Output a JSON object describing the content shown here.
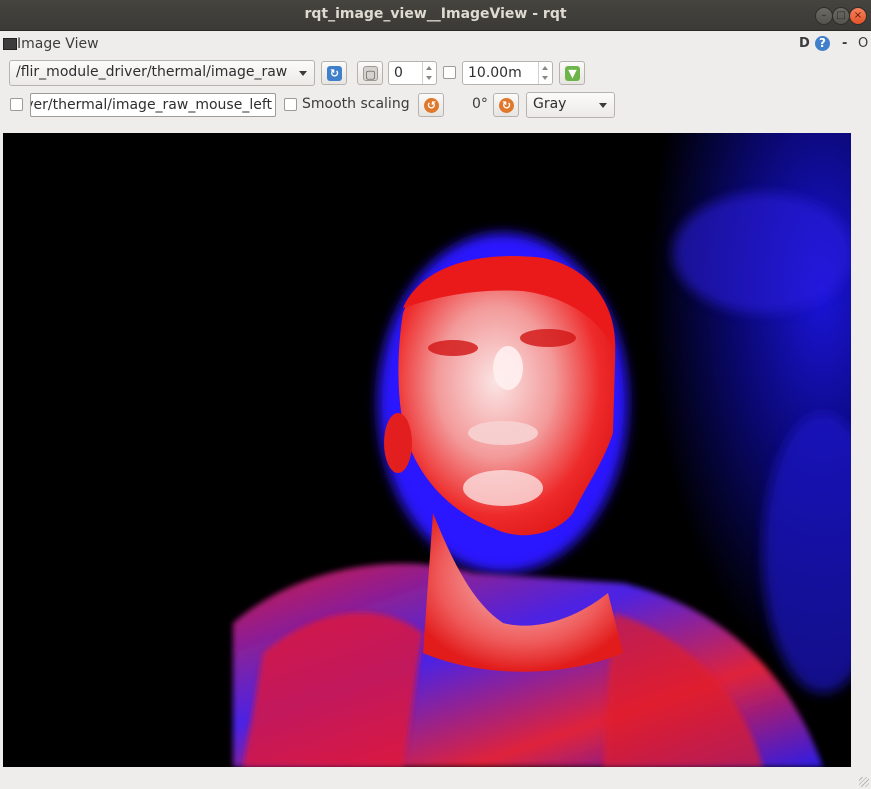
{
  "window": {
    "title": "rqt_image_view__ImageView - rqt"
  },
  "panel": {
    "title": "Image View",
    "d_label": "D",
    "help_label": "?",
    "minimize_label": "-",
    "close_label": "O"
  },
  "toolbar": {
    "topic": "/flir_module_driver/thermal/image_raw",
    "frame_value": "0",
    "duration_value": "10.00m",
    "mouse_topic": "ver/thermal/image_raw_mouse_left",
    "smooth_scaling_label": "Smooth scaling",
    "rotation_label": "0°",
    "colormap": "Gray"
  },
  "colors": {
    "titlebar": "#3f3e3a",
    "close": "#e8572d",
    "accent": "#3f7fcc"
  },
  "icons": [
    "refresh-icon",
    "zoom-fit-icon",
    "save-icon",
    "rotate-left-icon",
    "rotate-right-icon",
    "help-icon"
  ]
}
